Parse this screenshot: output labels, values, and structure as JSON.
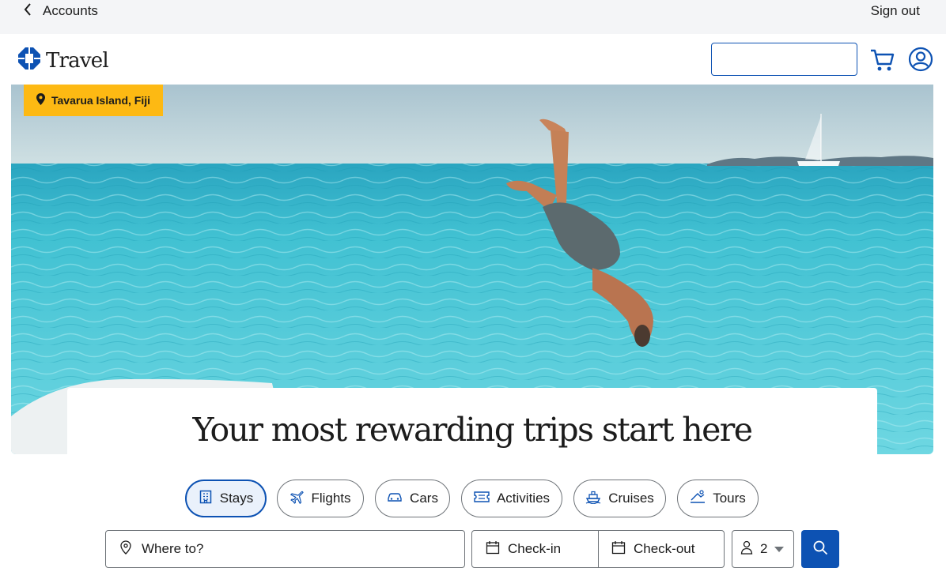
{
  "topbar": {
    "back_label": "Accounts",
    "signout_label": "Sign out"
  },
  "header": {
    "logo_text": "Travel",
    "search_placeholder": ""
  },
  "hero": {
    "location": "Tavarua Island, Fiji",
    "headline": "Your most rewarding trips start here"
  },
  "tabs": [
    {
      "label": "Stays",
      "icon": "building-icon",
      "active": true
    },
    {
      "label": "Flights",
      "icon": "airplane-icon",
      "active": false
    },
    {
      "label": "Cars",
      "icon": "car-icon",
      "active": false
    },
    {
      "label": "Activities",
      "icon": "ticket-icon",
      "active": false
    },
    {
      "label": "Cruises",
      "icon": "ship-icon",
      "active": false
    },
    {
      "label": "Tours",
      "icon": "tour-icon",
      "active": false
    }
  ],
  "search": {
    "destination_placeholder": "Where to?",
    "checkin_label": "Check-in",
    "checkout_label": "Check-out",
    "guests_value": "2"
  },
  "colors": {
    "brand_blue": "#0d52b3",
    "badge_yellow": "#fdb913"
  }
}
